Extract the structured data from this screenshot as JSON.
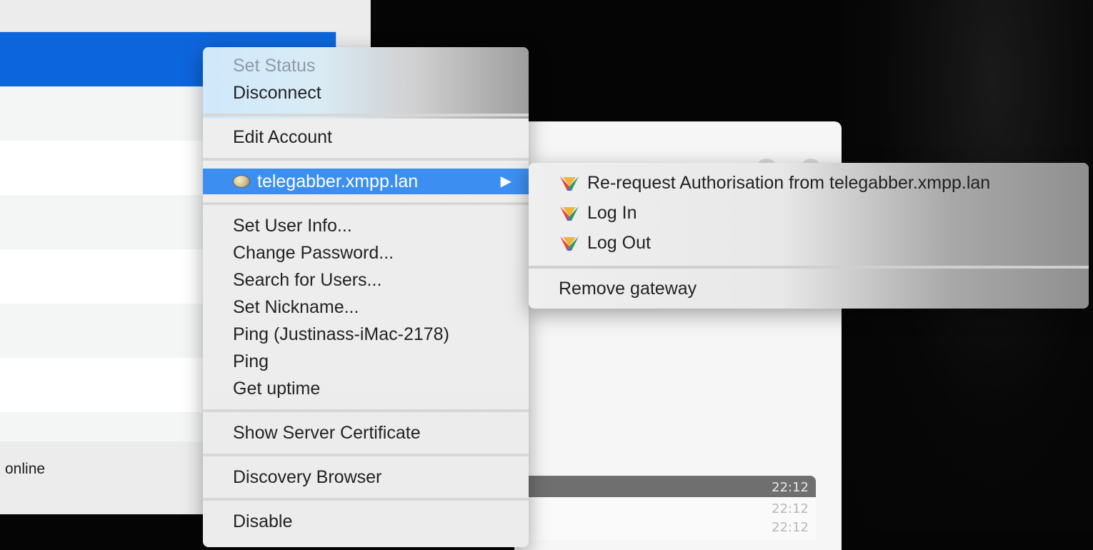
{
  "left_window": {
    "status_text": "online"
  },
  "chat_log": {
    "timestamps": [
      "22:12",
      "22:12",
      "22:12"
    ]
  },
  "context_menu": {
    "set_status": "Set Status",
    "disconnect": "Disconnect",
    "edit_account": "Edit Account",
    "gateway": "telegabber.xmpp.lan",
    "submenu_arrow": "▶",
    "set_user_info": "Set User Info...",
    "change_password": "Change Password...",
    "search_for_users": "Search for Users...",
    "set_nickname": "Set Nickname...",
    "ping_resource": "Ping (Justinass-iMac-2178)",
    "ping": "Ping",
    "get_uptime": "Get uptime",
    "show_server_certificate": "Show Server Certificate",
    "discovery_browser": "Discovery Browser",
    "disable": "Disable"
  },
  "submenu": {
    "rerequest_auth": "Re-request Authorisation from telegabber.xmpp.lan",
    "log_in": "Log In",
    "log_out": "Log Out",
    "remove_gateway": "Remove gateway"
  },
  "colors": {
    "selection": "#0d65dd",
    "menu_highlight": "#3c8ff0"
  }
}
